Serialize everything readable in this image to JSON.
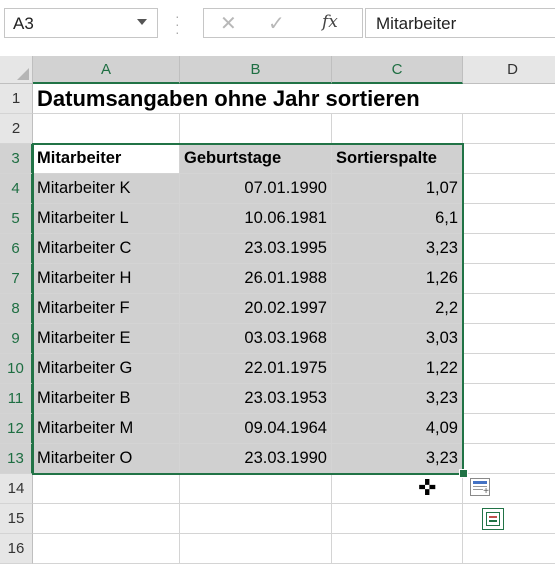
{
  "formula_bar": {
    "name_box": "A3",
    "formula": "Mitarbeiter",
    "fx_label": "fx"
  },
  "columns": [
    {
      "label": "A"
    },
    {
      "label": "B"
    },
    {
      "label": "C"
    },
    {
      "label": "D"
    }
  ],
  "rows": [
    "1",
    "2",
    "3",
    "4",
    "5",
    "6",
    "7",
    "8",
    "9",
    "10",
    "11",
    "12",
    "13",
    "14",
    "15",
    "16"
  ],
  "sheet": {
    "title": "Datumsangaben ohne Jahr sortieren",
    "headers": [
      "Mitarbeiter",
      "Geburtstage",
      "Sortierspalte"
    ],
    "records": [
      [
        "Mitarbeiter K",
        "07.01.1990",
        "1,07"
      ],
      [
        "Mitarbeiter L",
        "10.06.1981",
        "6,1"
      ],
      [
        "Mitarbeiter C",
        "23.03.1995",
        "3,23"
      ],
      [
        "Mitarbeiter H",
        "26.01.1988",
        "1,26"
      ],
      [
        "Mitarbeiter F",
        "20.02.1997",
        "2,2"
      ],
      [
        "Mitarbeiter E",
        "03.03.1968",
        "3,03"
      ],
      [
        "Mitarbeiter G",
        "22.01.1975",
        "1,22"
      ],
      [
        "Mitarbeiter B",
        "23.03.1953",
        "3,23"
      ],
      [
        "Mitarbeiter M",
        "09.04.1964",
        "4,09"
      ],
      [
        "Mitarbeiter O",
        "23.03.1990",
        "3,23"
      ]
    ]
  },
  "colors": {
    "selection": "#217346",
    "highlight": "#d0d0d0",
    "header_bg": "#e6e6e6"
  }
}
